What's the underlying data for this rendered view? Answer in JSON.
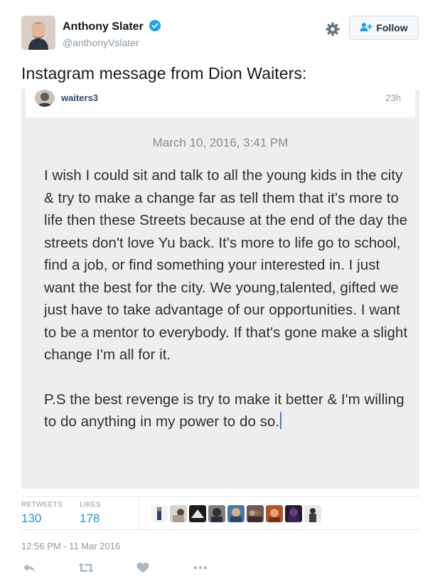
{
  "author": {
    "display_name": "Anthony Slater",
    "handle": "@anthonyVslater",
    "verified": true
  },
  "header": {
    "settings_icon": "gear-icon",
    "follow_label": "Follow",
    "follow_icon": "add-user-icon"
  },
  "tweet": {
    "text": "Instagram message from Dion Waiters:"
  },
  "screenshot": {
    "username": "waiters3",
    "age": "23h",
    "date": "March 10, 2016, 3:41 PM",
    "paragraph1": "I wish I could sit and talk to all the young kids in the city & try to make a change far as tell them that it's more to life then these Streets because at the end of the day the streets don't love Yu back. It's more to life go to school, find a job, or find something your interested in. I just want the best for the city. We young,talented, gifted we just have to take advantage of our opportunities. I want to be a mentor to everybody. If that's gone make a slight change I'm all for it.",
    "paragraph2": "P.S the best revenge is try to make it better & I'm willing to do anything in my power to do so."
  },
  "stats": {
    "retweets_label": "RETWEETS",
    "retweets_value": "130",
    "likes_label": "LIKES",
    "likes_value": "178",
    "liker_avatar_count_label": ""
  },
  "timestamp": "12:56 PM - 11 Mar 2016",
  "actions": [
    "reply-icon",
    "retweet-icon",
    "like-icon",
    "more-icon"
  ],
  "colors": {
    "accent": "#1b95e0",
    "verified": "#1da1f2",
    "muted": "#8899a6"
  }
}
